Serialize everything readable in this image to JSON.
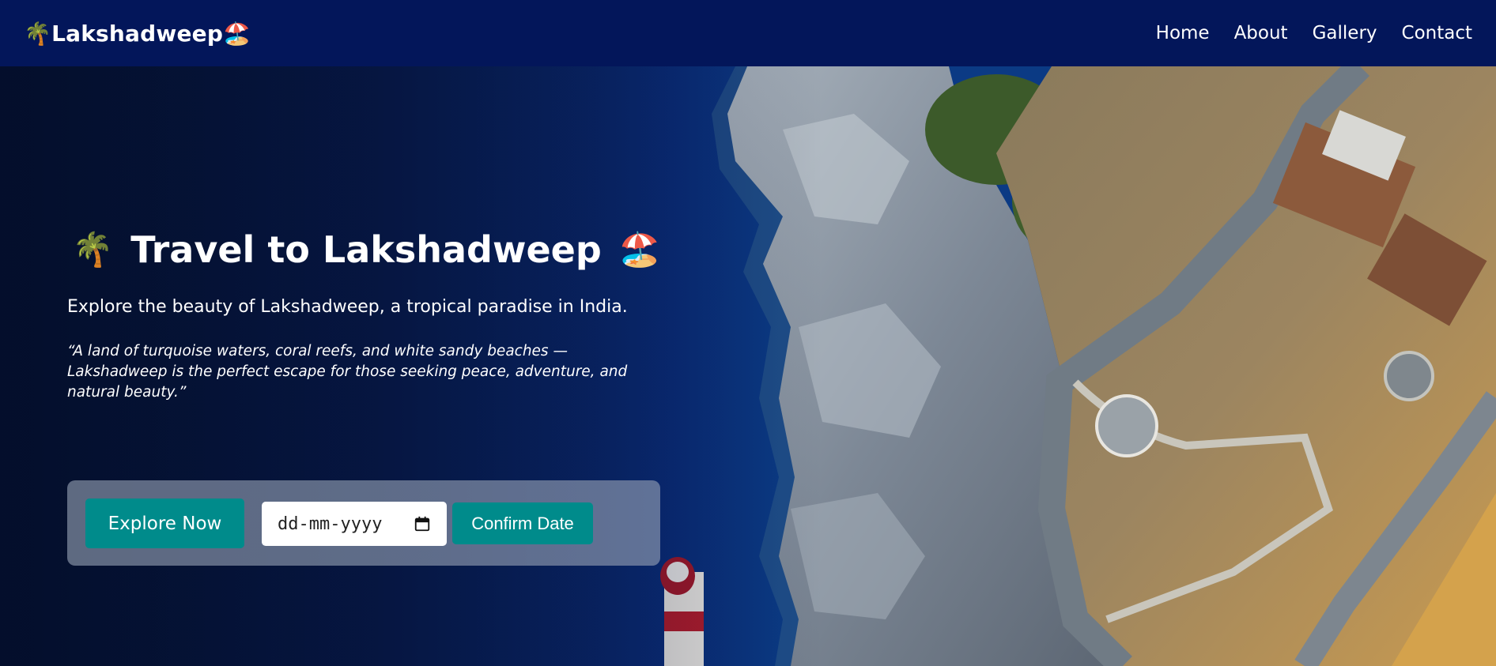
{
  "navbar": {
    "brand_left_emoji": "🌴",
    "brand_text": "Lakshadweep",
    "brand_right_emoji": "🏖️",
    "links": [
      "Home",
      "About",
      "Gallery",
      "Contact"
    ]
  },
  "hero": {
    "title_left_emoji": "🌴",
    "title_text": "Travel to Lakshadweep",
    "title_right_emoji": "🏖️",
    "subtitle": "Explore the beauty of Lakshadweep, a tropical paradise in India.",
    "quote": "“A land of turquoise waters, coral reefs, and white sandy beaches — Lakshadweep is the perfect escape for those seeking peace, adventure, and natural beauty.”",
    "explore_button": "Explore Now",
    "date_placeholder": "dd-mm-yyyy",
    "confirm_button": "Confirm Date"
  },
  "colors": {
    "navbar_bg": "#03165a",
    "button_bg": "#008b8b",
    "panel_bg": "rgba(150,162,180,0.62)"
  },
  "icons": {
    "date_picker": "calendar-icon"
  }
}
